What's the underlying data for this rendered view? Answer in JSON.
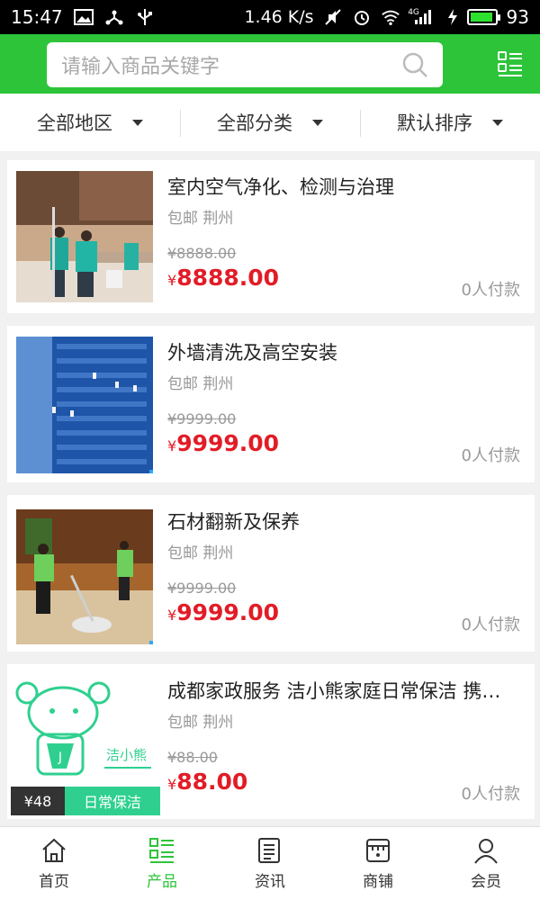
{
  "status_bar": {
    "time": "15:47",
    "network_speed": "1.46 K/s",
    "signal_label": "4G",
    "battery_percent": "93"
  },
  "search": {
    "placeholder": "请输入商品关键字"
  },
  "filters": [
    {
      "label": "全部地区"
    },
    {
      "label": "全部分类"
    },
    {
      "label": "默认排序"
    }
  ],
  "products": [
    {
      "title": "室内空气净化、检测与治理",
      "sub": "包邮 荆州",
      "old_price": "¥8888.00",
      "price_symbol": "¥",
      "price": "8888.00",
      "sold": "0人付款"
    },
    {
      "title": "外墙清洗及高空安装",
      "sub": "包邮 荆州",
      "old_price": "¥9999.00",
      "price_symbol": "¥",
      "price": "9999.00",
      "sold": "0人付款"
    },
    {
      "title": "石材翻新及保养",
      "sub": "包邮 荆州",
      "old_price": "¥9999.00",
      "price_symbol": "¥",
      "price": "9999.00",
      "sold": "0人付款"
    },
    {
      "title": "成都家政服务 洁小熊家庭日常保洁 携…",
      "sub": "包邮 荆州",
      "old_price": "¥88.00",
      "price_symbol": "¥",
      "price": "88.00",
      "sold": "0人付款",
      "thumb_brand": "洁小熊",
      "thumb_price_tag": "¥48",
      "thumb_tag": "日常保洁"
    }
  ],
  "tabs": [
    {
      "label": "首页",
      "icon": "home-icon"
    },
    {
      "label": "产品",
      "icon": "product-list-icon",
      "active": true
    },
    {
      "label": "资讯",
      "icon": "news-icon"
    },
    {
      "label": "商铺",
      "icon": "shop-icon"
    },
    {
      "label": "会员",
      "icon": "member-icon"
    }
  ],
  "colors": {
    "brand_green": "#2dc43a",
    "price_red": "#e21c26"
  }
}
